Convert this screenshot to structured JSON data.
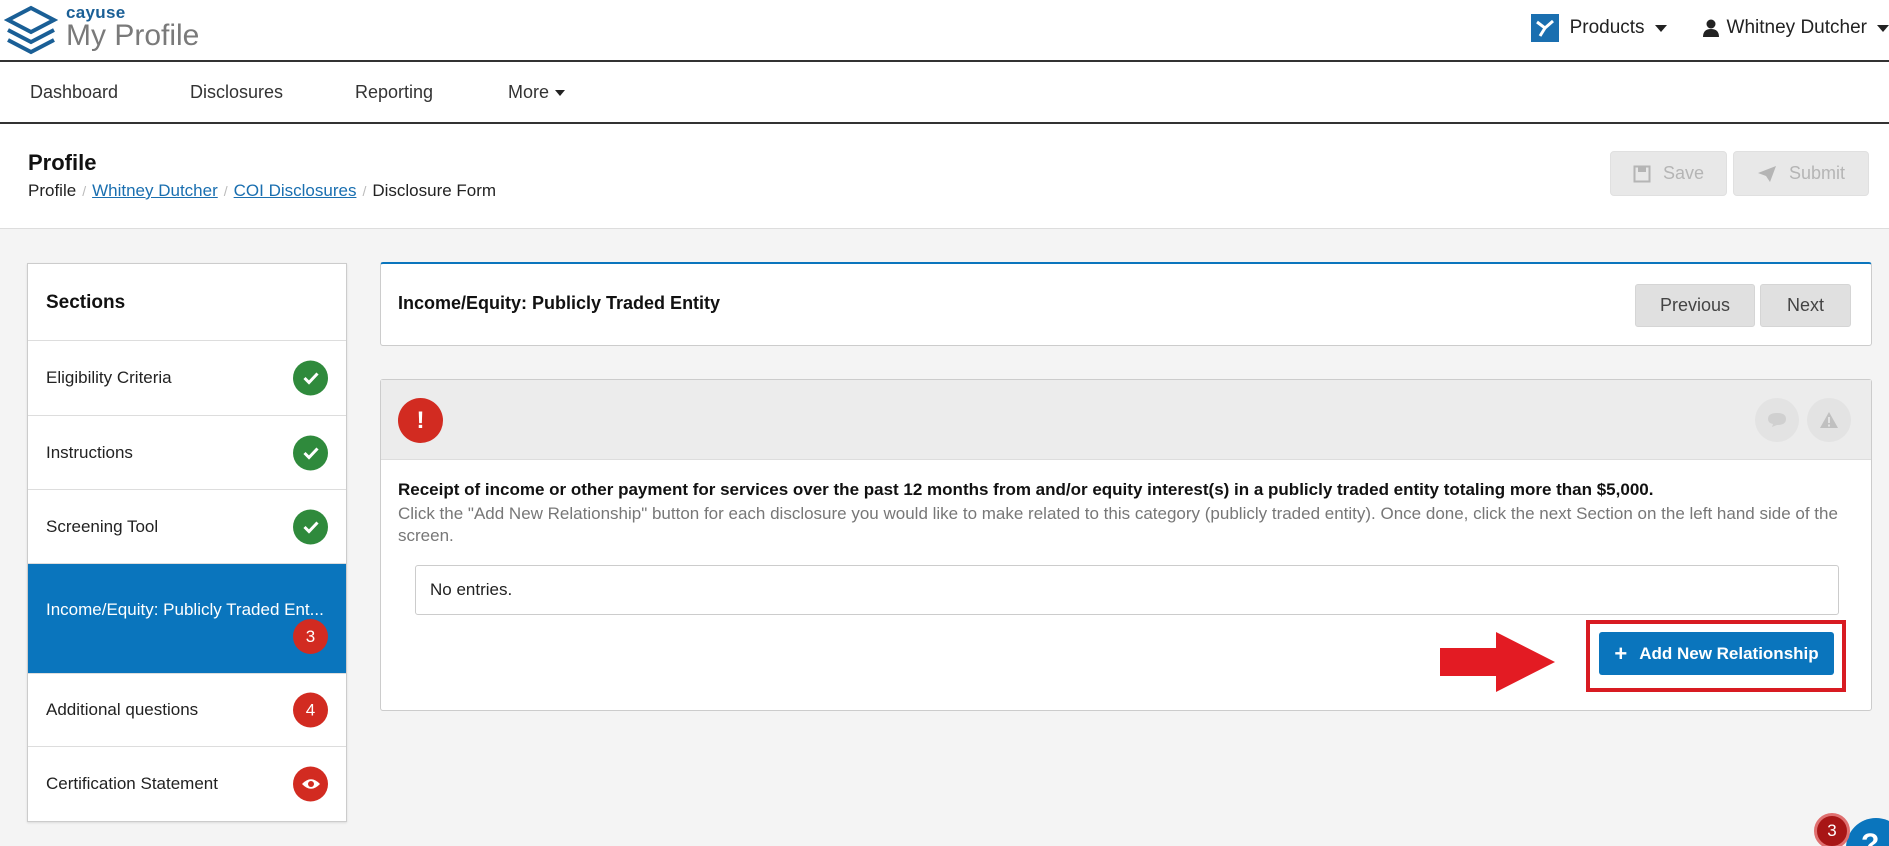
{
  "app": {
    "brand": "cayuse",
    "name": "My Profile"
  },
  "header": {
    "products_label": "Products",
    "user_name": "Whitney Dutcher"
  },
  "nav": {
    "items": [
      "Dashboard",
      "Disclosures",
      "Reporting",
      "More"
    ]
  },
  "page": {
    "title": "Profile",
    "breadcrumb": [
      "Profile",
      "Whitney Dutcher",
      "COI Disclosures",
      "Disclosure Form"
    ],
    "save_label": "Save",
    "submit_label": "Submit"
  },
  "sidebar": {
    "heading": "Sections",
    "items": [
      {
        "label": "Eligibility Criteria",
        "status": "complete"
      },
      {
        "label": "Instructions",
        "status": "complete"
      },
      {
        "label": "Screening Tool",
        "status": "complete"
      },
      {
        "label": "Income/Equity: Publicly Traded Ent...",
        "status": "errors",
        "badge": "3",
        "active": true
      },
      {
        "label": "Additional questions",
        "status": "errors",
        "badge": "4"
      },
      {
        "label": "Certification Statement",
        "status": "view"
      }
    ]
  },
  "section": {
    "title": "Income/Equity: Publicly Traded Entity",
    "previous_label": "Previous",
    "next_label": "Next"
  },
  "question": {
    "alert": "!",
    "text": "Receipt of income or other payment for services over the past 12 months from and/or equity interest(s) in a publicly traded entity totaling more than $5,000.",
    "help": "Click the \"Add New Relationship\" button for each disclosure you would like to make related to this category (publicly traded entity).  Once done, click the next Section on the left hand side of the screen.",
    "empty_text": "No entries.",
    "add_label": "Add New Relationship"
  },
  "help_widget": {
    "count": "3",
    "symbol": "?"
  },
  "colors": {
    "primary": "#0a75bd",
    "success": "#2f8a3c",
    "danger": "#d22b21",
    "annotation": "#d81b22"
  }
}
